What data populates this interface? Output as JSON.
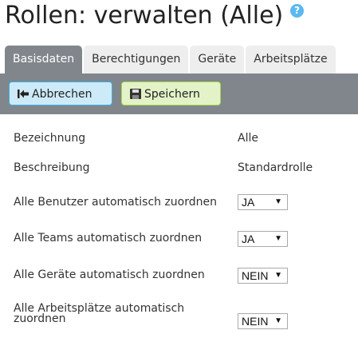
{
  "header": {
    "title": "Rollen: verwalten (Alle)",
    "help_icon": "question-circle-icon"
  },
  "tabs": [
    {
      "label": "Basisdaten",
      "active": true
    },
    {
      "label": "Berechtigungen"
    },
    {
      "label": "Geräte"
    },
    {
      "label": "Arbeitsplätze"
    }
  ],
  "toolbar": {
    "cancel_label": "Abbrechen",
    "save_label": "Speichern"
  },
  "fields": {
    "bezeichnung": {
      "label": "Bezeichnung",
      "value": "Alle"
    },
    "beschreibung": {
      "label": "Beschreibung",
      "value": "Standardrolle"
    },
    "benutzer": {
      "label": "Alle Benutzer automatisch zuordnen",
      "value": "JA"
    },
    "teams": {
      "label": "Alle Teams automatisch zuordnen",
      "value": "JA"
    },
    "geraete": {
      "label": "Alle Geräte automatisch zuordnen",
      "value": "NEIN"
    },
    "arbeitsplaetze": {
      "label": "Alle Arbeitsplätze automatisch zuordnen",
      "value": "NEIN"
    }
  }
}
